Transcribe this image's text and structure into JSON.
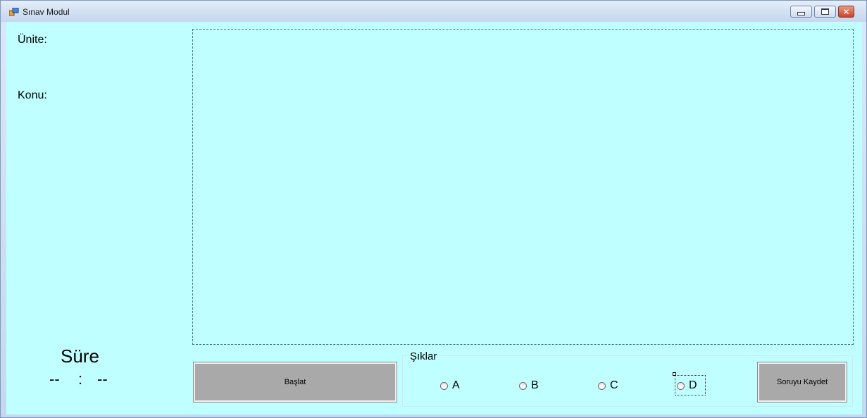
{
  "window": {
    "title": "Sınav Modul",
    "icon": "app-form-icon"
  },
  "labels": {
    "unite": "Ünite:",
    "konu": "Konu:"
  },
  "question": {
    "text": ""
  },
  "timer": {
    "title": "Süre",
    "minutes": "--",
    "separator": ":",
    "seconds": "--"
  },
  "buttons": {
    "start": "Başlat",
    "save_question": "Soruyu Kaydet"
  },
  "choices": {
    "legend": "Şıklar",
    "options": [
      {
        "label": "A",
        "checked": false
      },
      {
        "label": "B",
        "checked": false
      },
      {
        "label": "C",
        "checked": false
      },
      {
        "label": "D",
        "checked": false
      }
    ],
    "focused": "D"
  },
  "colors": {
    "client_background": "#c0ffff",
    "button_face": "#a9a9a9",
    "close_button": "#c9442a"
  }
}
